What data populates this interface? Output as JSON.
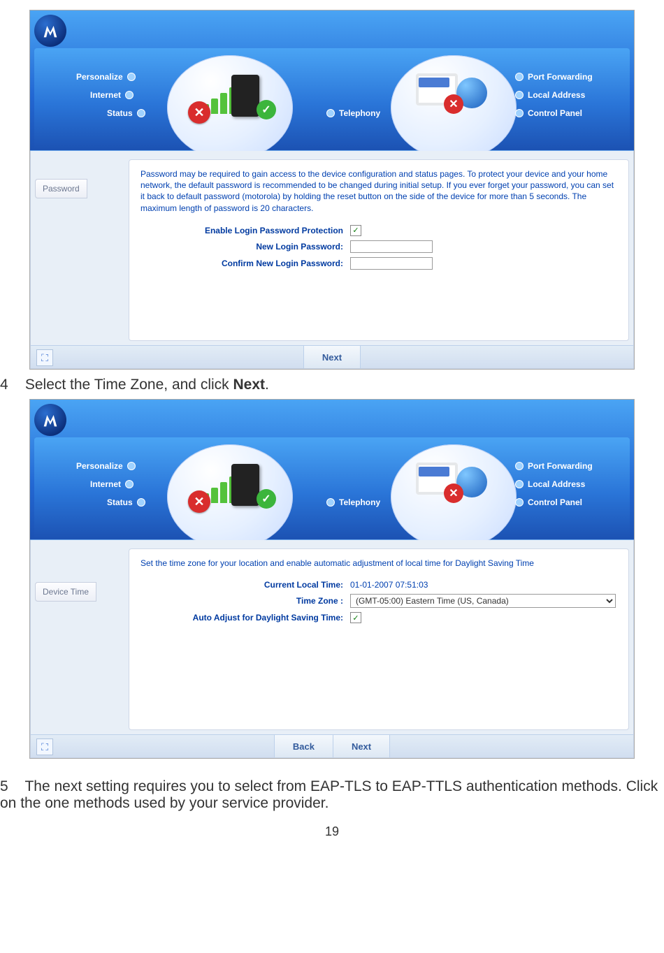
{
  "steps": {
    "s4": {
      "num": "4",
      "text_before": "Select the Time Zone, and click ",
      "bold": "Next",
      "text_after": "."
    },
    "s5": {
      "num": "5",
      "text": "The next setting requires you to select from EAP-TLS to EAP-TTLS authentication methods. Click on the one methods used by your service provider."
    }
  },
  "nav": {
    "personalize": "Personalize",
    "internet": "Internet",
    "status": "Status",
    "telephony": "Telephony",
    "port_forwarding": "Port Forwarding",
    "local_address": "Local Address",
    "control_panel": "Control Panel"
  },
  "shot1": {
    "side_tab": "Password",
    "info": "Password may be required to gain access to the device configuration and status pages. To protect your device and your home network, the default password is recommended to be changed during initial setup. If you ever forget your password, you can set it back to default password (motorola) by holding the reset button on the side of the device for more than 5 seconds. The maximum length of password is 20 characters.",
    "row1_label": "Enable Login Password Protection",
    "row2_label": "New Login Password:",
    "row3_label": "Confirm New Login Password:",
    "next": "Next"
  },
  "shot2": {
    "side_tab": "Device Time",
    "info": "Set the time zone for your location and enable automatic adjustment of local time for Daylight Saving Time",
    "row1_label": "Current Local Time:",
    "row1_value": "01-01-2007 07:51:03",
    "row2_label": "Time Zone :",
    "row2_value": "(GMT-05:00) Eastern Time (US, Canada)",
    "row3_label": "Auto Adjust for Daylight Saving Time:",
    "back": "Back",
    "next": "Next"
  },
  "page_number": "19"
}
